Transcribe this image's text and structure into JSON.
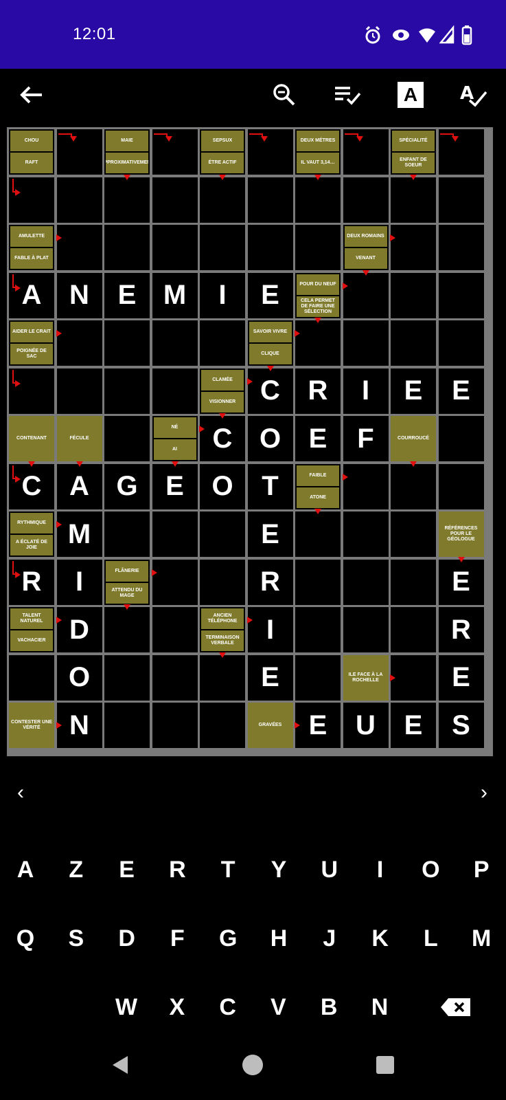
{
  "status_bar": {
    "time": "12:01"
  },
  "toolbar": {
    "back": "back-arrow-icon",
    "zoom_out": "zoom-out-icon",
    "check_list": "check-list-icon",
    "letter_toggle": "A",
    "spellcheck": "spellcheck-icon"
  },
  "colors": {
    "status_bar": "#2a0aa5",
    "clue_bg": "#7f7a2c",
    "arrow": "#e01010",
    "grid_line": "#7a7a7a"
  },
  "clues": [
    "CHOU",
    "RAFT",
    "MAIE",
    "APPROXIMATIVEMENT",
    "SEPSUX",
    "ÉTRE ACTIF",
    "DEUX MÉTRES",
    "IL VAUT 3,14…",
    "SPÉCIALITÉ",
    "ENFANT DE SOEUR",
    "AMULETTE",
    "FABLE À PLAT",
    "DEUX ROMAINS",
    "VENANT",
    "POUR DU NEUF",
    "CELA PERMET DE FAIRE UNE SÉLECTION",
    "AIDER LE CRAIT",
    "POIGNÉE DE SAC",
    "SAVOIR VIVRE",
    "CLIQUE",
    "CLAMÉE",
    "VISIONNER",
    "CONTENANT",
    "FÉCULE",
    "NÉ",
    "AI",
    "COURROUCÉ",
    "FAIBLE",
    "ATONE",
    "RYTHMIQUE",
    "A ÉCLATÉ DE JOIE",
    "RÉFÉRENCES POUR LE GÉOLOGUE",
    "FLÂNERIE",
    "ATTENDU DU MAGE",
    "TALENT NATUREL",
    "VACHACIER",
    "ANCIEN TÉLÉPHONE",
    "TERMINAISON VERBALE",
    "ILE FACE À LA ROCHELLE",
    "CONTESTER UNE VÉRITÉ",
    "GRAVÉES"
  ],
  "answers": {
    "row4": [
      "A",
      "N",
      "E",
      "M",
      "I",
      "E"
    ],
    "row7": [
      "C",
      "R",
      "I",
      "E",
      "E"
    ],
    "row8": [
      "C",
      "O",
      "E",
      "F"
    ],
    "row9": [
      "C",
      "A",
      "G",
      "E",
      "O",
      "T"
    ],
    "col_t": [
      "E",
      "R",
      "I",
      "E"
    ],
    "col_m": [
      "M",
      "I",
      "D",
      "O",
      "N"
    ],
    "col_r": [
      "R"
    ],
    "col_e10": [
      "E",
      "R",
      "E",
      "S"
    ],
    "row15": [
      "E",
      "U",
      "E",
      "S"
    ]
  },
  "nav": {
    "prev": "‹",
    "next": "›"
  },
  "keyboard": {
    "row1": [
      "A",
      "Z",
      "E",
      "R",
      "T",
      "Y",
      "U",
      "I",
      "O",
      "P"
    ],
    "row2": [
      "Q",
      "S",
      "D",
      "F",
      "G",
      "H",
      "J",
      "K",
      "L",
      "M"
    ],
    "row3": [
      "W",
      "X",
      "C",
      "V",
      "B",
      "N"
    ],
    "backspace": "backspace-icon"
  },
  "system_nav": {
    "back": "back-triangle-icon",
    "home": "home-circle-icon",
    "recents": "recents-square-icon"
  }
}
